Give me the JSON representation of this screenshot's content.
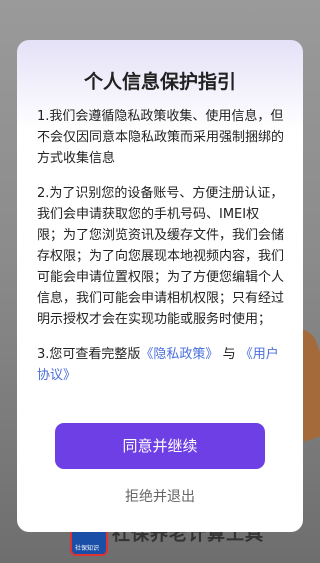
{
  "background": {
    "app_title": "社保养老计算工具",
    "logo_text": "社保知识"
  },
  "dialog": {
    "title": "个人信息保护指引",
    "p1": "1.我们会遵循隐私政策收集、使用信息，但不会仅因同意本隐私政策而采用强制捆绑的方式收集信息",
    "p2": "2.为了识别您的设备账号、方便注册认证，我们会申请获取您的手机号码、IMEI权限；为了您浏览资讯及缓存文件，我们会储存权限；为了向您展现本地视频内容，我们可能会申请位置权限；为了方便您编辑个人信息，我们可能会申请相机权限；只有经过明示授权才会在实现功能或服务时使用；",
    "p3_prefix": "3.您可查看完整版",
    "privacy_link": "《隐私政策》",
    "p3_and": "与",
    "agreement_link": "《用户协议》",
    "agree_button": "同意并继续",
    "reject_button": "拒绝并退出"
  },
  "colors": {
    "accent": "#6e3fe4",
    "link": "#4a6fdc"
  }
}
